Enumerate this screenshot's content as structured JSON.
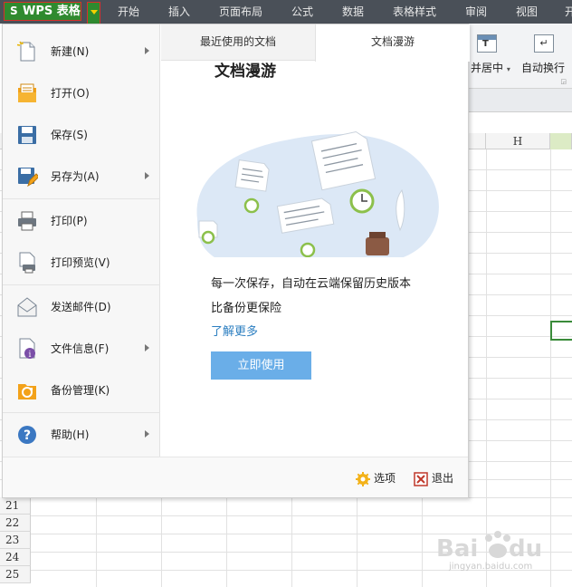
{
  "app": {
    "button_label": "WPS 表格",
    "logo_glyph": "S"
  },
  "menu_tabs": [
    "开始",
    "插入",
    "页面布局",
    "公式",
    "数据",
    "表格样式",
    "审阅",
    "视图",
    "开"
  ],
  "ribbon": {
    "merge_label": "并居中",
    "wrap_label": "自动换行",
    "merge_icon_text": "T",
    "wrap_icon_text": "↵"
  },
  "sheet": {
    "column_h": "H",
    "row_numbers": [
      "21",
      "22",
      "23",
      "24",
      "25"
    ]
  },
  "file_menu": {
    "items": [
      {
        "label": "新建(N)",
        "has_arrow": true
      },
      {
        "label": "打开(O)",
        "has_arrow": false
      },
      {
        "label": "保存(S)",
        "has_arrow": false
      },
      {
        "label": "另存为(A)",
        "has_arrow": true
      },
      {
        "label": "打印(P)",
        "has_arrow": false
      },
      {
        "label": "打印预览(V)",
        "has_arrow": false
      },
      {
        "label": "发送邮件(D)",
        "has_arrow": false
      },
      {
        "label": "文件信息(F)",
        "has_arrow": true
      },
      {
        "label": "备份管理(K)",
        "has_arrow": false
      },
      {
        "label": "帮助(H)",
        "has_arrow": true
      }
    ]
  },
  "panel_tabs": {
    "recent": "最近使用的文档",
    "roaming": "文档漫游"
  },
  "roaming": {
    "title": "文档漫游",
    "desc_line1": "每一次保存，自动在云端保留历史版本",
    "desc_line2": "比备份更保险",
    "learn_more": "了解更多",
    "use_now": "立即使用"
  },
  "footer": {
    "options": "选项",
    "exit": "退出"
  },
  "watermark": {
    "brand": "Bai du 经验",
    "url": "jingyan.baidu.com"
  },
  "colors": {
    "app_green": "#2f8a2f",
    "menubar": "#4a5058",
    "accent_blue": "#6aaee8",
    "link_blue": "#2d7fc1",
    "highlight_red": "#d9302a"
  }
}
